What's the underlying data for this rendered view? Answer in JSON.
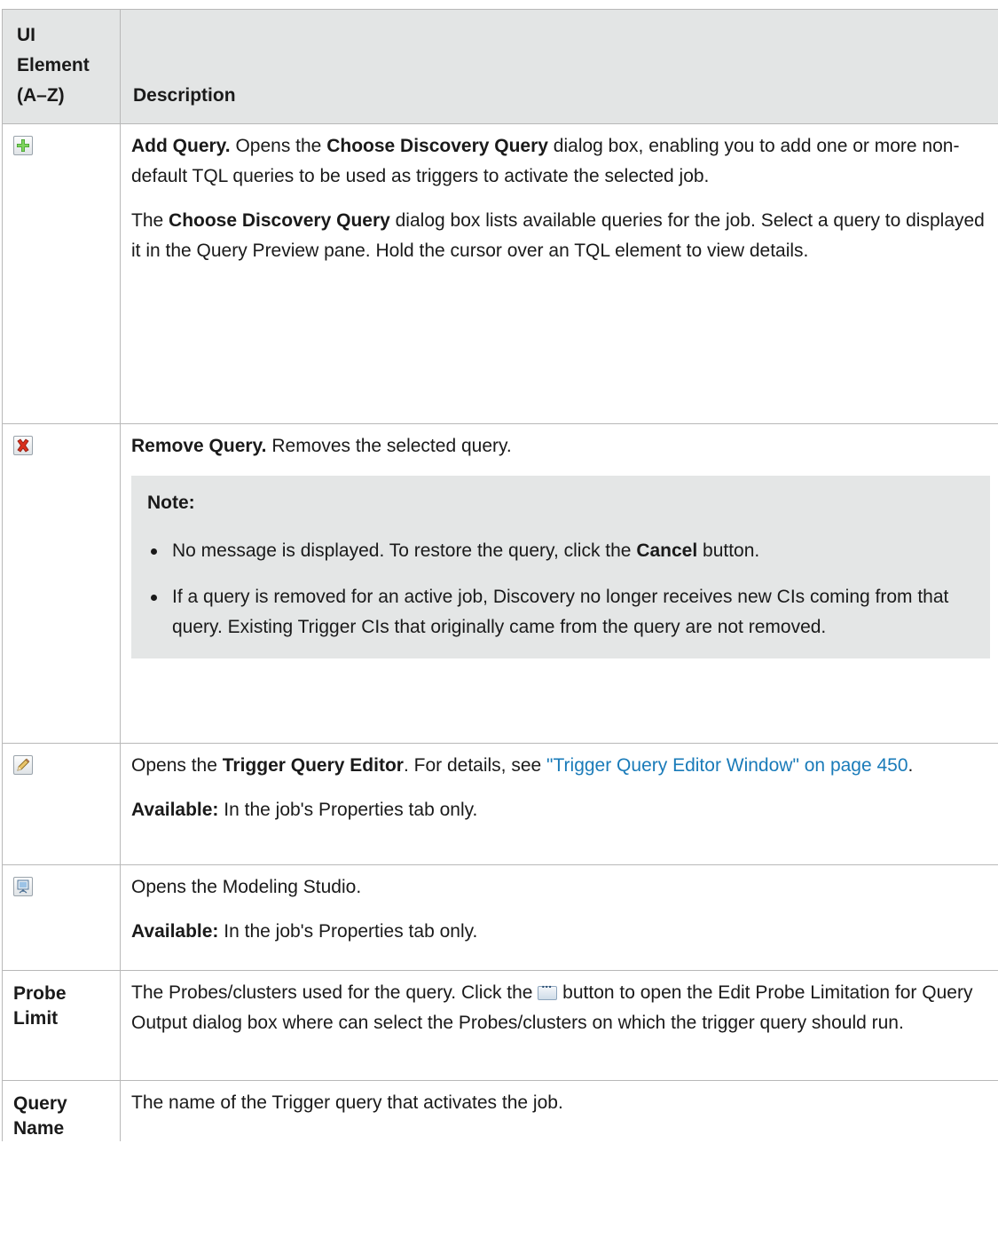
{
  "table": {
    "headers": {
      "col1_lines": [
        "UI",
        "Element",
        "(A–Z)"
      ],
      "col2": "Description"
    },
    "rows": [
      {
        "icon": "add-icon",
        "p1": {
          "t1": "Add Query.",
          "t2": " Opens the ",
          "t3": "Choose Discovery Query",
          "t4": " dialog box, enabling you to add one or more non-default TQL queries to be used as triggers to activate the selected job."
        },
        "p2": {
          "t1": "The ",
          "t2": "Choose Discovery Query",
          "t3": " dialog box lists available queries for the job. Select a query to displayed it in the Query Preview pane. Hold the cursor over an TQL element to view details."
        }
      },
      {
        "icon": "remove-icon",
        "p1": {
          "t1": "Remove Query.",
          "t2": " Removes the selected query."
        },
        "note": {
          "title": "Note:",
          "item1": {
            "t1": "No message is displayed. To restore the query, click the ",
            "t2": "Cancel",
            "t3": " button."
          },
          "item2": "If a query is removed for an active job, Discovery no longer receives new CIs coming from that query. Existing Trigger CIs that originally came from the query are not removed."
        }
      },
      {
        "icon": "pencil-icon",
        "p1": {
          "t1": "Opens the ",
          "t2": "Trigger Query Editor",
          "t3": ". For details, see ",
          "link": "\"Trigger Query Editor Window\" on page 450",
          "t4": "."
        },
        "p2": {
          "t1": "Available:",
          "t2": " In the job's Properties tab only."
        }
      },
      {
        "icon": "modeling-studio-icon",
        "p1": "Opens the Modeling Studio.",
        "p2": {
          "t1": "Available:",
          "t2": " In the job's Properties tab only."
        }
      },
      {
        "name_lines": [
          "Probe",
          "Limit"
        ],
        "p1": {
          "t1": "The Probes/clusters used for the query. Click the ",
          "button_glyph": "...",
          "t2": " button to open the Edit Probe Limitation for Query Output dialog box where can select the Probes/clusters on which the trigger query should run."
        }
      },
      {
        "name_lines": [
          "Query",
          "Name"
        ],
        "p1": "The name of the Trigger query that activates the job."
      }
    ]
  },
  "colors": {
    "header_bg": "#e3e5e5",
    "note_bg": "#e4e6e6",
    "link": "#1a7bb9",
    "border": "#b8b8b8"
  }
}
